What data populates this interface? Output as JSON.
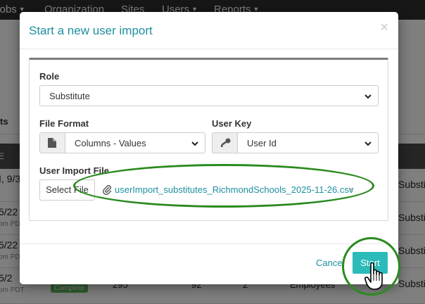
{
  "nav": {
    "items": [
      "Jobs",
      "Organization",
      "Sites",
      "Users",
      "Reports"
    ]
  },
  "background": {
    "tab_label": "ts",
    "header_label": "E",
    "rows": [
      {
        "date": "I, 9/3",
        "sub": "",
        "right": "Substi"
      },
      {
        "date": "5/22",
        "sub": "om PD",
        "right": "Substi"
      },
      {
        "date": "5/22",
        "sub": "om PDT",
        "right": "Substi"
      },
      {
        "date": "5/2",
        "sub": "om PDT",
        "right": "Substi",
        "badge": "Complete",
        "n1": "295",
        "n2": "92",
        "n3": "2",
        "type": "Employees"
      }
    ]
  },
  "modal": {
    "title": "Start a new user import",
    "close": "×",
    "role": {
      "label": "Role",
      "value": "Substitute"
    },
    "file_format": {
      "label": "File Format",
      "value": "Columns - Values"
    },
    "user_key": {
      "label": "User Key",
      "value": "User Id"
    },
    "import_file": {
      "label": "User Import File",
      "button_label": "Select File",
      "file_name": "userImport_substitutes_RichmondSchools_2025-11-26.csv",
      "remove": "×"
    },
    "cancel_label": "Cancel",
    "start_label": "Start"
  },
  "colors": {
    "accent": "#1e8fa0",
    "start_button": "#2bbbb9",
    "highlight": "#2a8a1e",
    "nav": "#2f2f2f"
  },
  "icons": [
    "file-icon",
    "key-icon",
    "paperclip-icon",
    "chevron-down-icon",
    "hand-cursor-icon"
  ]
}
